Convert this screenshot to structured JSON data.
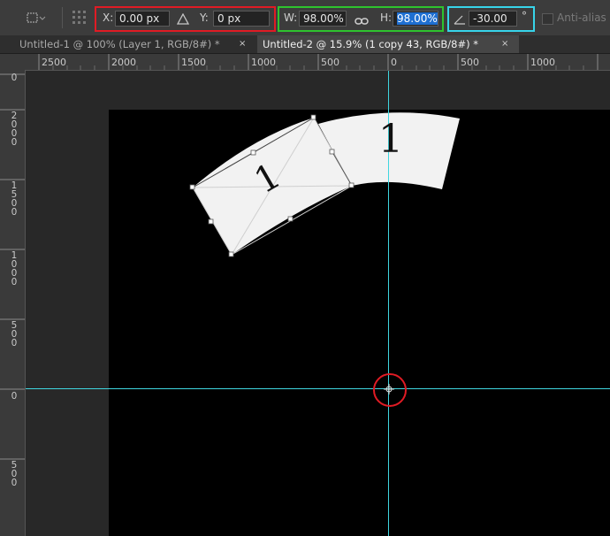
{
  "options_bar": {
    "x_label": "X:",
    "x_value": "0.00 px",
    "delta_icon": "delta-triangle",
    "y_label": "Y:",
    "y_value": "0 px",
    "w_label": "W:",
    "w_value": "98.00%",
    "link_icon": "chain-link",
    "h_label": "H:",
    "h_value": "98.00%",
    "angle_icon": "angle",
    "angle_value": "-30.00",
    "degree_symbol": "°",
    "antialias_label": "Anti-alias",
    "highlight_colors": {
      "xy_box": "#e01b24",
      "wh_box": "#2ec32e",
      "angle_box": "#37d4ea"
    }
  },
  "tabs": [
    {
      "label": "Untitled-1 @ 100% (Layer 1, RGB/8#) *",
      "close": "×",
      "active": false
    },
    {
      "label": "Untitled-2 @ 15.9% (1 copy 43, RGB/8#) *",
      "close": "×",
      "active": true
    }
  ],
  "ruler_h": [
    "2500",
    "2000",
    "1500",
    "1000",
    "500",
    "0",
    "500",
    "1000"
  ],
  "ruler_v": [
    [
      "0"
    ],
    [
      "2",
      "0",
      "0",
      "0"
    ],
    [
      "1",
      "5",
      "0",
      "0"
    ],
    [
      "1",
      "0",
      "0",
      "0"
    ],
    [
      "5",
      "0",
      "0"
    ],
    [
      "0"
    ],
    [
      "5",
      "0",
      "0"
    ]
  ],
  "canvas": {
    "shape_glyph_left": "1",
    "shape_glyph_right": "1",
    "guide_color": "#3fd6e0",
    "pivot_marker_color": "#e01b24"
  }
}
